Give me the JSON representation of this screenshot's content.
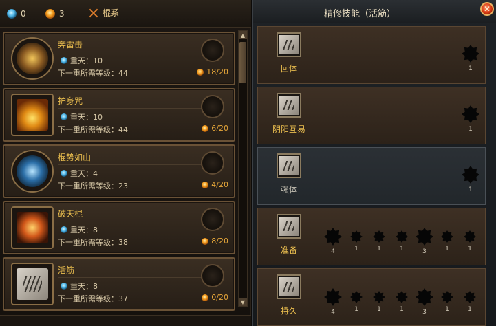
{
  "currency": {
    "blue": "0",
    "orange": "3"
  },
  "tab": {
    "label": "棍系"
  },
  "skills": [
    {
      "name": "奔雷击",
      "tier": "重天：10",
      "req": "下一重所需等级：44",
      "prog": "18/20"
    },
    {
      "name": "护身咒",
      "tier": "重天：10",
      "req": "下一重所需等级：44",
      "prog": "6/20"
    },
    {
      "name": "棍势如山",
      "tier": "重天：4",
      "req": "下一重所需等级：23",
      "prog": "4/20"
    },
    {
      "name": "破天棍",
      "tier": "重天：8",
      "req": "下一重所需等级：38",
      "prog": "8/20"
    },
    {
      "name": "活筋",
      "tier": "重天：8",
      "req": "下一重所需等级：37",
      "prog": "0/20"
    }
  ],
  "right": {
    "title": "精修技能（活筋）",
    "rows": [
      {
        "name": "回体",
        "levels": [
          "1"
        ]
      },
      {
        "name": "阴阳互易",
        "levels": [
          "1"
        ]
      },
      {
        "name": "强体",
        "levels": [
          "1"
        ]
      },
      {
        "name": "准备",
        "levels": [
          "4",
          "1",
          "1",
          "1",
          "3",
          "1",
          "1"
        ]
      },
      {
        "name": "持久",
        "levels": [
          "4",
          "1",
          "1",
          "1",
          "3",
          "1",
          "1"
        ]
      }
    ]
  },
  "colors": {
    "accent": "#e8bc4e",
    "progress": "#e8a83a",
    "close": "#d83a12"
  },
  "icons": {
    "blue_currency": "blue-gem-icon",
    "orange_currency": "orange-gem-icon",
    "tab": "crossed-swords-icon",
    "close": "close-icon"
  }
}
